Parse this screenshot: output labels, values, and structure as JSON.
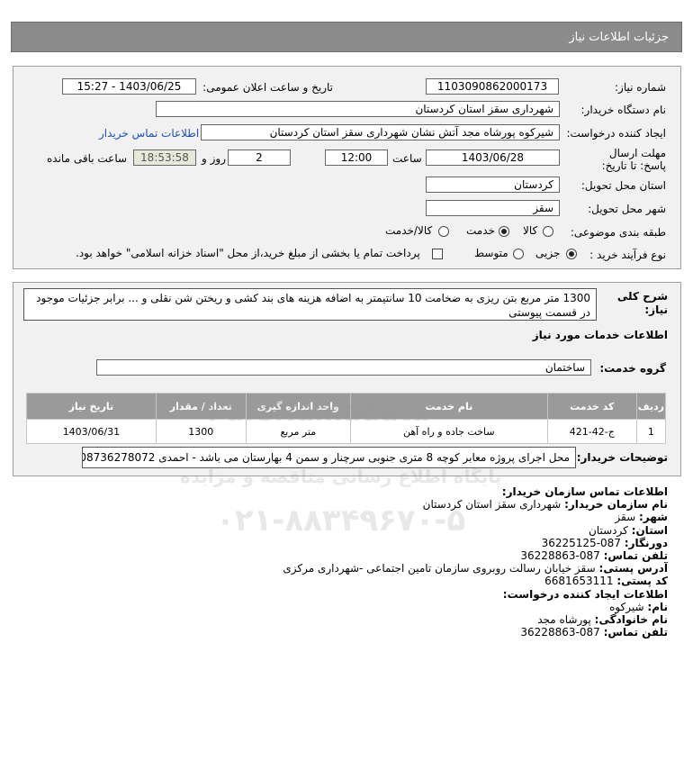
{
  "header": {
    "title": "جزئیات اطلاعات نیاز"
  },
  "form": {
    "need_number_label": "شماره نیاز:",
    "need_number": "1103090862000173",
    "announce_label": "تاریخ و ساعت اعلان عمومی:",
    "announce_value": "1403/06/25 - 15:27",
    "buyer_org_label": "نام دستگاه خریدار:",
    "buyer_org": "شهرداری سقز استان کردستان",
    "creator_label": "ایجاد کننده درخواست:",
    "creator": "شیرکوه پورشاه مجد آتش نشان شهرداری سقز استان کردستان",
    "contact_link": "اطلاعات تماس خریدار",
    "deadline_label": "مهلت ارسال پاسخ: تا تاریخ:",
    "deadline_date": "1403/06/28",
    "time_label": "ساعت",
    "deadline_time": "12:00",
    "days": "2",
    "days_label": "روز و",
    "remaining": "18:53:58",
    "remaining_label": "ساعت باقی مانده",
    "province_label": "استان محل تحویل:",
    "province": "کردستان",
    "city_label": "شهر محل تحویل:",
    "city": "سقز",
    "category_label": "طبقه بندی موضوعی:",
    "category_options": [
      "کالا",
      "خدمت",
      "کالا/خدمت"
    ],
    "category_selected": "خدمت",
    "process_label": "نوع فرآیند خرید :",
    "process_options": [
      "جزیی",
      "متوسط"
    ],
    "process_selected": "جزیی",
    "payment_note": "پرداخت تمام یا بخشی از مبلغ خرید،از محل \"اسناد خزانه اسلامی\" خواهد بود."
  },
  "details": {
    "summary_label": "شرح کلی نیاز:",
    "summary": "1300 متر مربع بتن ریزی به ضخامت 10 سانتیمتر به اضافه هزینه های بند کشی و ریختن شن نقلی و ... برابر جزئیات موجود در قسمت پیوستی",
    "services_title": "اطلاعات خدمات مورد نیاز",
    "service_group_label": "گروه خدمت:",
    "service_group": "ساختمان",
    "table_headers": [
      "ردیف",
      "کد خدمت",
      "نام خدمت",
      "واحد اندازه گیری",
      "تعداد / مقدار",
      "تاریخ نیاز"
    ],
    "table_rows": [
      [
        "1",
        "ج-42-421",
        "ساخت جاده و راه آهن",
        "متر مربع",
        "1300",
        "1403/06/31"
      ]
    ],
    "buyer_notes_label": "توضیحات خریدار:",
    "buyer_notes": "محل اجرای پروژه معابر کوچه 8 متری جنوبی سرچنار و سمن 4 بهارستان می باشد - احمدی 08736278072"
  },
  "contact": {
    "org_title": "اطلاعات تماس سازمان خریدار:",
    "org_name_label": "نام سازمان خریدار:",
    "org_name": "شهرداری سقز استان کردستان",
    "city_label": "شهر:",
    "city": "سقز",
    "province_label": "استان:",
    "province": "کردستان",
    "fax_label": "دورنگار:",
    "fax": "087-36225125",
    "phone_label": "تلفن تماس:",
    "phone": "087-36228863",
    "address_label": "آدرس پستی:",
    "address": "سقز خیابان رسالت روبروی سازمان تامین اجتماعی -شهرداری مرکزی",
    "postal_label": "کد پستی:",
    "postal": "6681653111",
    "creator_title": "اطلاعات ایجاد کننده درخواست:",
    "first_name_label": "نام:",
    "first_name": "شیرکوه",
    "last_name_label": "نام خانوادگی:",
    "last_name": "پورشاه مجد",
    "creator_phone_label": "تلفن تماس:",
    "creator_phone": "087-36228863"
  },
  "watermark": {
    "brand": "ParsNamadata",
    "line1": "پایگاه اطلاع رسانی مناقصه و مزایده",
    "phone": "۰۲۱-۸۸۳۴۹۶۷۰-۵"
  }
}
